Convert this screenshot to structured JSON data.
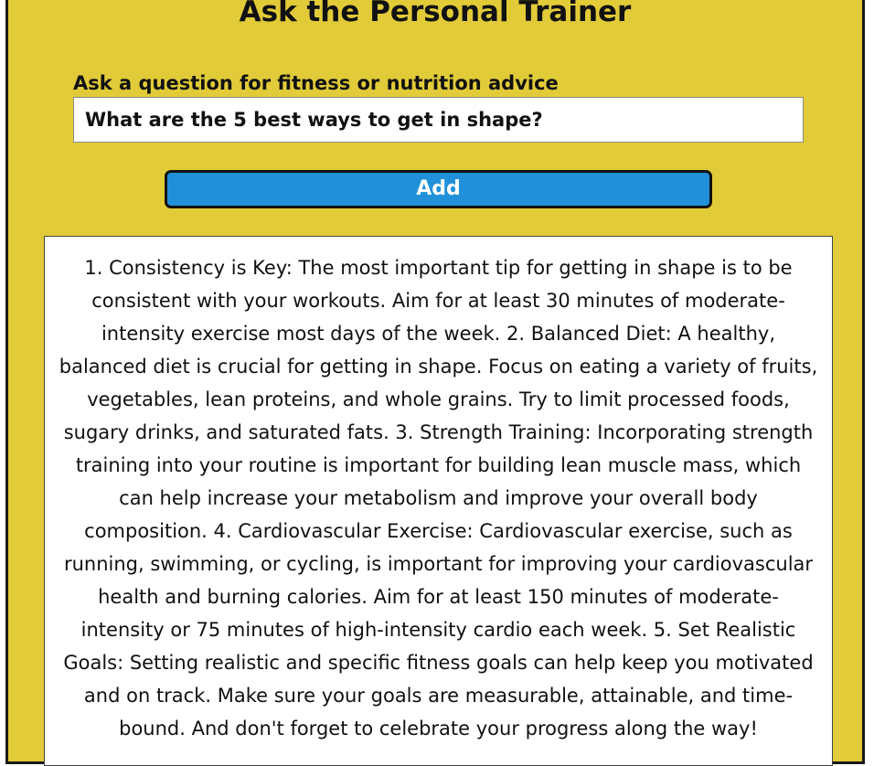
{
  "header": {
    "title": "Ask the Personal Trainer"
  },
  "form": {
    "label": "Ask a question for fitness or nutrition advice",
    "input_value": "What are the 5 best ways to get in shape?",
    "add_label": "Add"
  },
  "answer": {
    "text": "1. Consistency is Key: The most important tip for getting in shape is to be consistent with your workouts. Aim for at least 30 minutes of moderate-intensity exercise most days of the week. 2. Balanced Diet: A healthy, balanced diet is crucial for getting in shape. Focus on eating a variety of fruits, vegetables, lean proteins, and whole grains. Try to limit processed foods, sugary drinks, and saturated fats. 3. Strength Training: Incorporating strength training into your routine is important for building lean muscle mass, which can help increase your metabolism and improve your overall body composition. 4. Cardiovascular Exercise: Cardiovascular exercise, such as running, swimming, or cycling, is important for improving your cardiovascular health and burning calories. Aim for at least 150 minutes of moderate-intensity or 75 minutes of high-intensity cardio each week. 5. Set Realistic Goals: Setting realistic and specific fitness goals can help keep you motivated and on track. Make sure your goals are measurable, attainable, and time-bound. And don't forget to celebrate your progress along the way!"
  },
  "colors": {
    "background": "#e2cb38",
    "button": "#2090d8",
    "border": "#1a1a1a"
  }
}
